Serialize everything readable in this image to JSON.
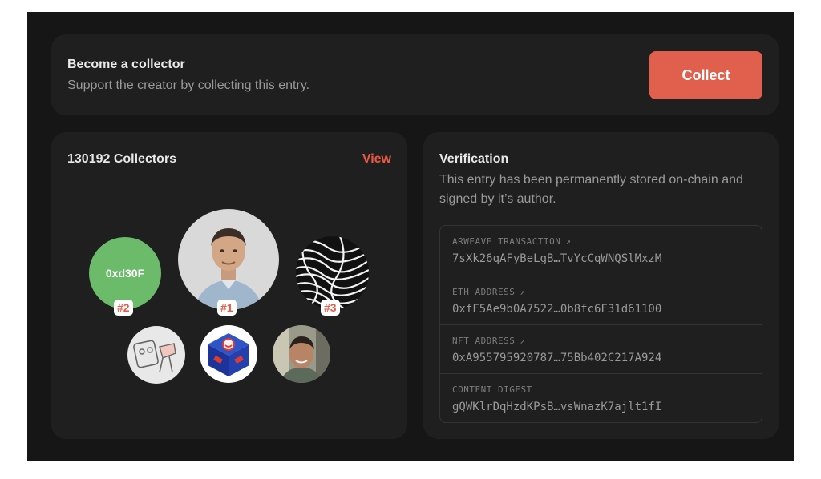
{
  "collect": {
    "title": "Become a collector",
    "subtitle": "Support the creator by collecting this entry.",
    "button_label": "Collect"
  },
  "collectors": {
    "count_label": "130192 Collectors",
    "view_label": "View",
    "top": [
      {
        "rank": "#2",
        "label": "0xd30F",
        "color": "#6bbb6b"
      },
      {
        "rank": "#1",
        "image": "portrait-photo"
      },
      {
        "rank": "#3",
        "image": "abstract-art"
      }
    ],
    "others": [
      {
        "image": "sketch-art"
      },
      {
        "image": "cube-art"
      },
      {
        "image": "selfie-photo"
      }
    ]
  },
  "verification": {
    "title": "Verification",
    "description": "This entry has been permanently stored on-chain and signed by it’s author.",
    "rows": [
      {
        "label": "ARWEAVE TRANSACTION",
        "arrow": "↗",
        "value": "7sXk26qAFyBeLgB…TvYcCqWNQSlMxzM"
      },
      {
        "label": "ETH ADDRESS",
        "arrow": "↗",
        "value": "0xfF5Ae9b0A7522…0b8fc6F31d61100"
      },
      {
        "label": "NFT ADDRESS",
        "arrow": "↗",
        "value": "0xA955795920787…75Bb402C217A924"
      },
      {
        "label": "CONTENT DIGEST",
        "value": "gQWKlrDqHzdKPsB…vsWnazK7ajlt1fI"
      }
    ]
  },
  "colors": {
    "accent": "#e0604d",
    "background": "#161616",
    "card": "#1f1f1f"
  }
}
